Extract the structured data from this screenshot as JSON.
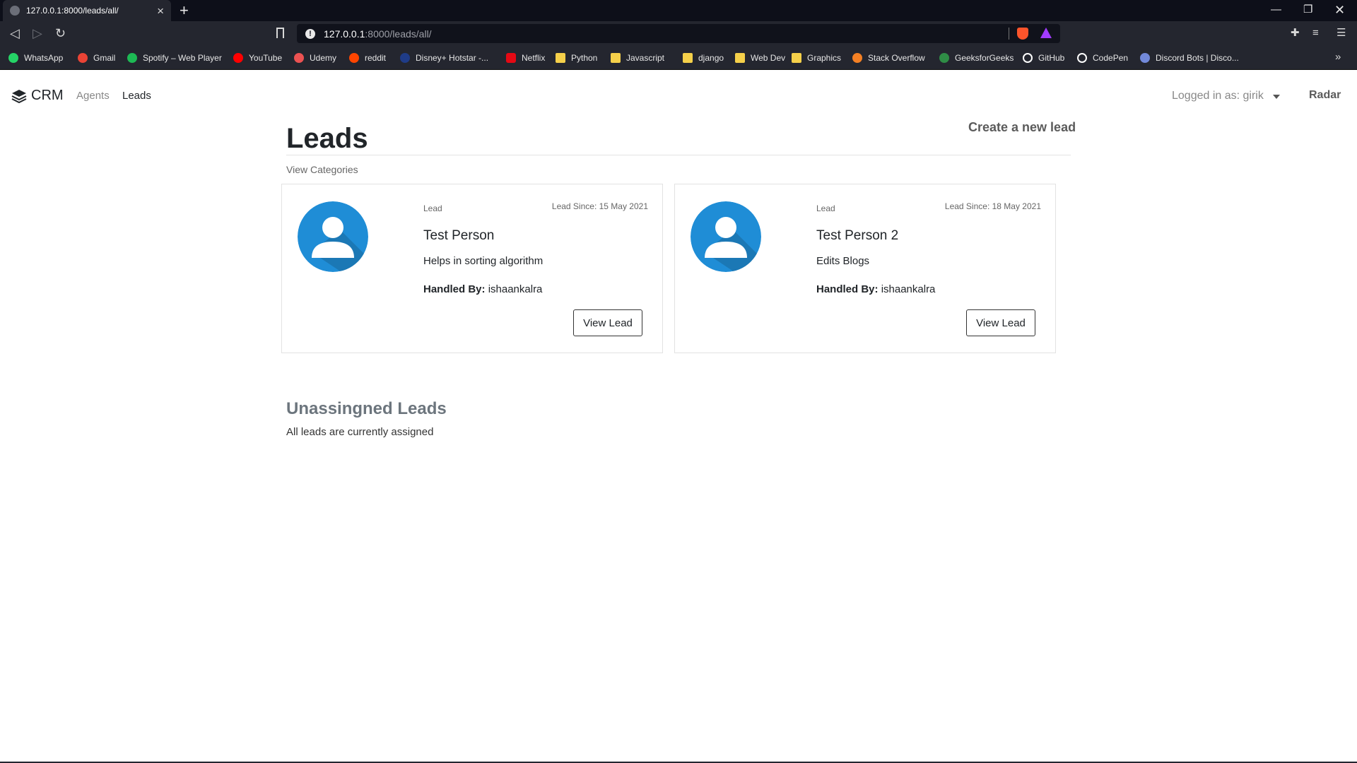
{
  "browser": {
    "tab_title": "127.0.0.1:8000/leads/all/",
    "url_host": "127.0.0.1",
    "url_rest": ":8000/leads/all/",
    "bookmarks": [
      {
        "label": "WhatsApp",
        "icon": "whatsapp-icon",
        "color": "#25d366"
      },
      {
        "label": "Gmail",
        "icon": "gmail-icon",
        "color": "#ea4335"
      },
      {
        "label": "Spotify – Web Player",
        "icon": "spotify-icon",
        "color": "#1db954"
      },
      {
        "label": "YouTube",
        "icon": "youtube-icon",
        "color": "#ff0000"
      },
      {
        "label": "Udemy",
        "icon": "udemy-icon",
        "color": "#ec5252"
      },
      {
        "label": "reddit",
        "icon": "reddit-icon",
        "color": "#ff4500"
      },
      {
        "label": "Disney+ Hotstar -...",
        "icon": "hotstar-icon",
        "color": "#1f3c88"
      },
      {
        "label": "Netflix",
        "icon": "netflix-icon",
        "color": "#e50914"
      },
      {
        "label": "Python",
        "icon": "folder-icon",
        "color": "#f5d04a"
      },
      {
        "label": "Javascript",
        "icon": "folder-icon",
        "color": "#f5d04a"
      },
      {
        "label": "django",
        "icon": "folder-icon",
        "color": "#f5d04a"
      },
      {
        "label": "Web Dev",
        "icon": "folder-icon",
        "color": "#f5d04a"
      },
      {
        "label": "Graphics",
        "icon": "folder-icon",
        "color": "#f5d04a"
      },
      {
        "label": "Stack Overflow",
        "icon": "stackoverflow-icon",
        "color": "#f48024"
      },
      {
        "label": "GeeksforGeeks",
        "icon": "geeksforgeeks-icon",
        "color": "#2f8d46"
      },
      {
        "label": "GitHub",
        "icon": "github-icon",
        "color": "#ffffff"
      },
      {
        "label": "CodePen",
        "icon": "codepen-icon",
        "color": "#ffffff"
      },
      {
        "label": "Discord Bots | Disco...",
        "icon": "discord-icon",
        "color": "#7289da"
      }
    ]
  },
  "nav": {
    "brand": "CRM",
    "agents": "Agents",
    "leads": "Leads",
    "logged_in": "Logged in as: girik",
    "radar": "Radar"
  },
  "main": {
    "title": "Leads",
    "create_link": "Create a new lead",
    "view_categories": "View Categories",
    "leads": [
      {
        "tag": "Lead",
        "since": "Lead Since: 15 May 2021",
        "name": "Test Person",
        "description": "Helps in sorting algorithm",
        "handled_label": "Handled By:",
        "handled_by": "ishaankalra",
        "button": "View Lead"
      },
      {
        "tag": "Lead",
        "since": "Lead Since: 18 May 2021",
        "name": "Test Person 2",
        "description": "Edits Blogs",
        "handled_label": "Handled By:",
        "handled_by": "ishaankalra",
        "button": "View Lead"
      }
    ],
    "unassigned_title": "Unassingned Leads",
    "unassigned_text": "All leads are currently assigned"
  },
  "colors": {
    "avatar_bg": "#1f8dd6",
    "avatar_shadow": "#1a6fa6"
  }
}
